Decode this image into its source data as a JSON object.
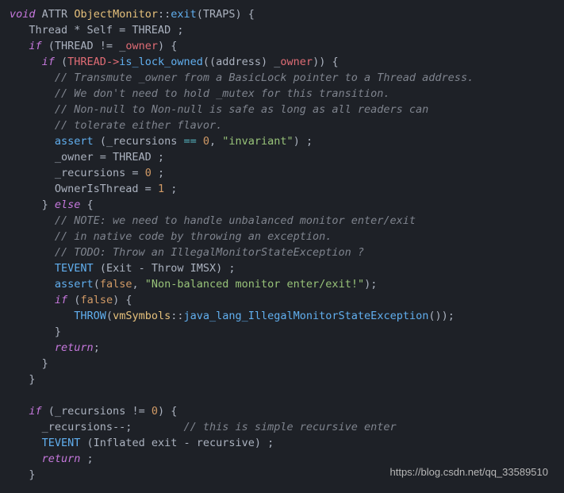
{
  "code": {
    "l1": {
      "kw": "void",
      "attr": "ATTR",
      "cls": "ObjectMonitor",
      "fn": "exit",
      "params": "(TRAPS) {"
    },
    "l2": {
      "text": "   Thread * Self = THREAD ;"
    },
    "l3": {
      "kw": "if",
      "cond": " (THREAD != _",
      "owner": "owner",
      "end": ") {"
    },
    "l4": {
      "kw": "if",
      "open": " (",
      "thread": "THREAD->",
      "fn": "is_lock_owned",
      "args": "((address) _",
      "owner": "owner",
      "end": ")) {"
    },
    "l5": "       // Transmute _owner from a BasicLock pointer to a Thread address.",
    "l6": "       // We don't need to hold _mutex for this transition.",
    "l7": "       // Non-null to Non-null is safe as long as all readers can",
    "l8": "       // tolerate either flavor.",
    "l9": {
      "fn": "assert",
      "open": " (_recursions",
      "op": " == ",
      "num": "0",
      "sep": ", ",
      "str": "\"invariant\"",
      "end": ") ;"
    },
    "l10": "       _owner = THREAD ;",
    "l11": "       _recursions = ",
    "l11num": "0",
    "l11end": " ;",
    "l12": "       OwnerIsThread = ",
    "l12num": "1",
    "l12end": " ;",
    "l13": {
      "close": "     } ",
      "kw": "else",
      "open": " {"
    },
    "l14": "       // NOTE: we need to handle unbalanced monitor enter/exit",
    "l15": "       // in native code by throwing an exception.",
    "l16": "       // TODO: Throw an IllegalMonitorStateException ?",
    "l17": {
      "fn": "TEVENT",
      "args": " (Exit - Throw IMSX) ;"
    },
    "l18": {
      "fn": "assert",
      "open": "(",
      "false": "false",
      "sep": ", ",
      "str": "\"Non-balanced monitor enter/exit!\"",
      "end": ");"
    },
    "l19": {
      "kw": "if",
      "open": " (",
      "false": "false",
      "end": ") {"
    },
    "l20": {
      "fn": "THROW",
      "open": "(",
      "ns": "vmSymbols",
      "scope": "::",
      "fn2": "java_lang_IllegalMonitorStateException",
      "end": "());"
    },
    "l21": "       }",
    "l22": {
      "kw": "return",
      "end": ";"
    },
    "l23": "     }",
    "l24": "   }",
    "l25": "",
    "l26": {
      "kw": "if",
      "cond": " (_recursions != ",
      "num": "0",
      "end": ") {"
    },
    "l27": {
      "stmt": "     _recursions--;        ",
      "cmt": "// this is simple recursive enter"
    },
    "l28": {
      "fn": "TEVENT",
      "args": " (Inflated exit - recursive) ;"
    },
    "l29": {
      "kw": "return",
      "end": " ;"
    },
    "l30": "   }"
  },
  "watermark": "https://blog.csdn.net/qq_33589510"
}
